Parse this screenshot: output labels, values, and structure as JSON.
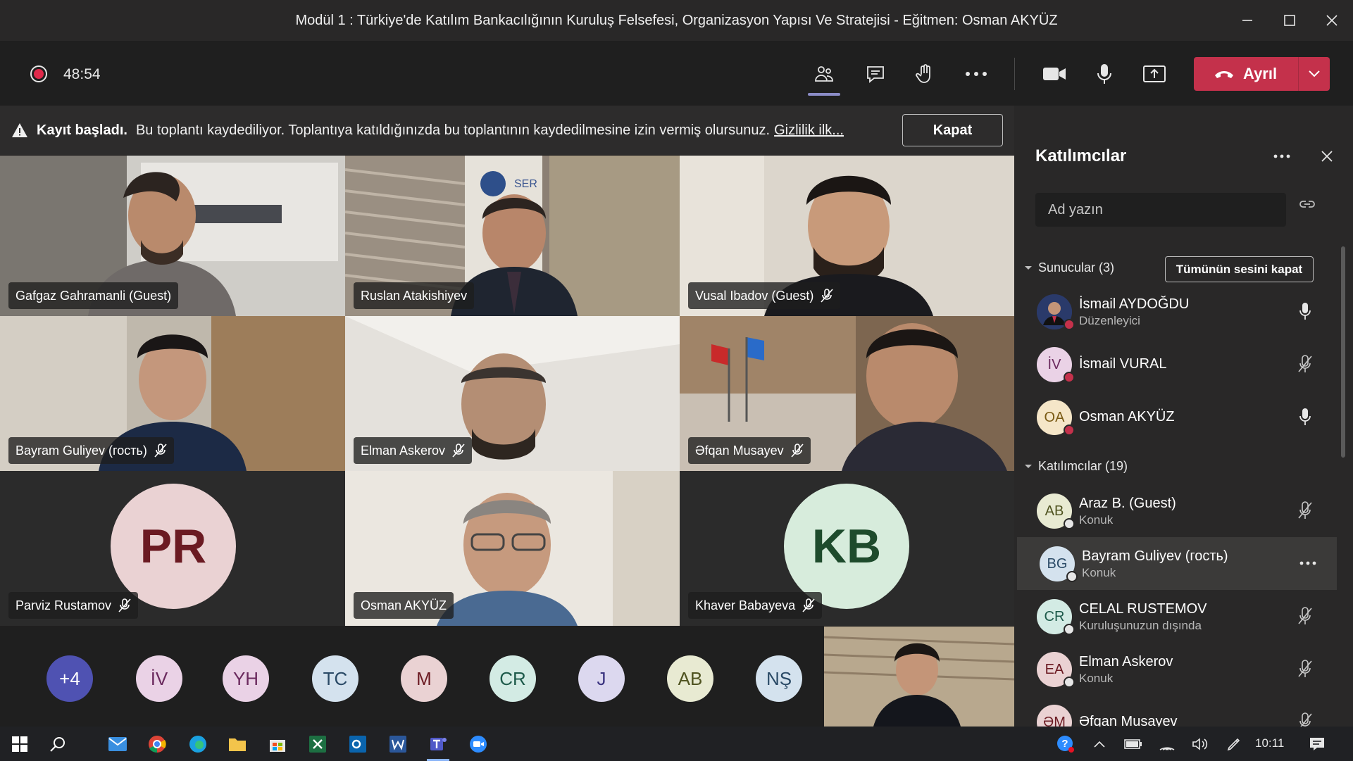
{
  "window": {
    "title": "Modül 1 : Türkiye'de Katılım Bankacılığının Kuruluş Felsefesi, Organizasyon Yapısı Ve Stratejisi - Eğitmen: Osman AKYÜZ"
  },
  "toolbar": {
    "timer": "48:54",
    "leave_label": "Ayrıl"
  },
  "banner": {
    "bold_text": "Kayıt başladı.",
    "text": "Bu toplantı kaydediliyor. Toplantıya katıldığınızda bu toplantının kaydedilmesine izin vermiş olursunuz.",
    "link": "Gizlilik ilk...",
    "close_label": "Kapat"
  },
  "video_tiles": [
    {
      "name": "Gafgaz Gahramanli (Guest)",
      "muted": false
    },
    {
      "name": "Ruslan Atakishiyev",
      "muted": false
    },
    {
      "name": "Vusal Ibadov (Guest)",
      "muted": true
    },
    {
      "name": "Bayram Guliyev (гость)",
      "muted": true
    },
    {
      "name": "Elman Askerov",
      "muted": true
    },
    {
      "name": "Əfqan Musayev",
      "muted": true
    },
    {
      "name": "Parviz Rustamov",
      "muted": true,
      "initials": "PR",
      "avatar_bg": "#ead2d3",
      "avatar_fg": "#6b1a22"
    },
    {
      "name": "Osman AKYÜZ",
      "muted": false
    },
    {
      "name": "Khaver Babayeva",
      "muted": true,
      "initials": "KB",
      "avatar_bg": "#d7ecdc",
      "avatar_fg": "#1e4b2c"
    }
  ],
  "overflow_strip": [
    {
      "label": "+4",
      "bg": "#4f52b2",
      "fg": "#ffffff"
    },
    {
      "label": "İV",
      "bg": "#ead2e6",
      "fg": "#6b2a5e"
    },
    {
      "label": "YH",
      "bg": "#ead2e6",
      "fg": "#6b2a5e"
    },
    {
      "label": "TC",
      "bg": "#d4e2ee",
      "fg": "#2a4a66"
    },
    {
      "label": "M",
      "bg": "#ead2d3",
      "fg": "#6b1a22"
    },
    {
      "label": "CR",
      "bg": "#d3ebe4",
      "fg": "#1d5a4a"
    },
    {
      "label": "J",
      "bg": "#dcd8ef",
      "fg": "#3b3480"
    },
    {
      "label": "AB",
      "bg": "#e8ead2",
      "fg": "#4f5320"
    },
    {
      "label": "NŞ",
      "bg": "#d4e2ee",
      "fg": "#2a4a66"
    }
  ],
  "panel": {
    "title": "Katılımcılar",
    "search_placeholder": "Ad yazın",
    "presenters_header": "Sunucular (3)",
    "mute_all": "Tümünün sesini kapat",
    "attendees_header": "Katılımcılar (19)",
    "presenters": [
      {
        "name": "İsmail AYDOĞDU",
        "role": "Düzenleyici",
        "initials": "",
        "bg": "#3a3a6a",
        "fg": "#ffffff",
        "mic": "on",
        "status": "#c4314b"
      },
      {
        "name": "İsmail VURAL",
        "role": "",
        "initials": "İV",
        "bg": "#ead2e6",
        "fg": "#6b2a5e",
        "mic": "off",
        "status": "#c4314b"
      },
      {
        "name": "Osman AKYÜZ",
        "role": "",
        "initials": "OA",
        "bg": "#f5e6c8",
        "fg": "#7a5a14",
        "mic": "on",
        "status": "#c4314b"
      }
    ],
    "attendees": [
      {
        "name": "Araz B. (Guest)",
        "role": "Konuk",
        "initials": "AB",
        "bg": "#e8ead2",
        "fg": "#4f5320",
        "mic": "off",
        "status": "#e6e6e6"
      },
      {
        "name": "Bayram Guliyev (гость)",
        "role": "Konuk",
        "initials": "BG",
        "bg": "#d4e2ee",
        "fg": "#2a4a66",
        "mic": "more",
        "status": "#e6e6e6"
      },
      {
        "name": "CELAL RUSTEMOV",
        "role": "Kuruluşunuzun dışında",
        "initials": "CR",
        "bg": "#d3ebe4",
        "fg": "#1d5a4a",
        "mic": "off",
        "status": "#e6e6e6"
      },
      {
        "name": "Elman Askerov",
        "role": "Konuk",
        "initials": "EA",
        "bg": "#ead2d3",
        "fg": "#6b1a22",
        "mic": "off",
        "status": "#e6e6e6"
      },
      {
        "name": "Əfqan Musayev",
        "role": "",
        "initials": "ƏM",
        "bg": "#ead2d3",
        "fg": "#6b1a22",
        "mic": "off",
        "status": "#e6e6e6"
      }
    ]
  },
  "taskbar": {
    "clock": "10:11"
  },
  "colors": {
    "accent": "#8b8cc7",
    "leave_red": "#c4314b",
    "panel_bg": "#292828"
  }
}
